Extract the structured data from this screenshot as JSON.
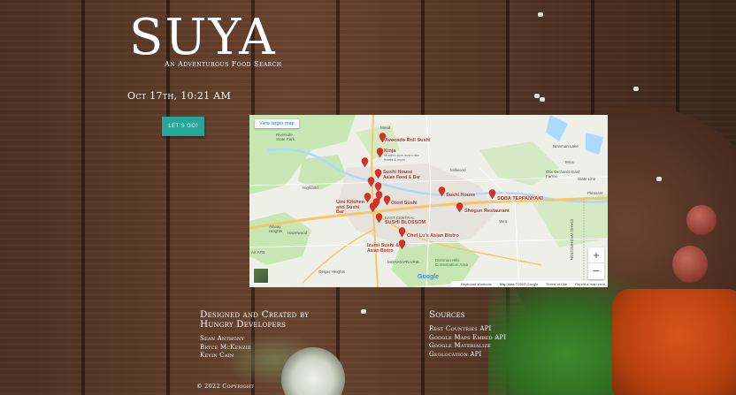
{
  "brand": {
    "title": "SUYA",
    "tagline": "An Adventurous Food Search"
  },
  "datetime": "Oct 17th, 10:21 AM",
  "lets_go_label": "LET'S GO!",
  "map": {
    "view_larger": "View larger map",
    "zoom_in": "+",
    "zoom_out": "−",
    "google": "Google",
    "footer": {
      "shortcuts": "Keyboard shortcuts",
      "data": "Map data ©2022 Google",
      "terms": "Terms of Use",
      "report": "Report a map error"
    },
    "places": [
      {
        "id": "mead",
        "label": "Mead"
      },
      {
        "id": "newman",
        "label": "Newman Lake"
      },
      {
        "id": "mica",
        "label": "Mica"
      },
      {
        "id": "otis",
        "label": "Otis Orchards-East Farms"
      },
      {
        "id": "stateline",
        "label": "State Line"
      },
      {
        "id": "pleasant",
        "label": "Pleasant"
      },
      {
        "id": "highland",
        "label": "Highland"
      },
      {
        "id": "airway",
        "label": "Airway Heights"
      },
      {
        "id": "hazelwood",
        "label": "Hazelwood"
      },
      {
        "id": "fairafb",
        "label": "Air AFB"
      },
      {
        "id": "geiger",
        "label": "Geiger Heights"
      },
      {
        "id": "vera",
        "label": "Vera"
      },
      {
        "id": "millwood",
        "label": "Millwood"
      },
      {
        "id": "east_central",
        "label": "EAST CENTRAL"
      },
      {
        "id": "moran",
        "label": "MORAN PRAIRIE"
      },
      {
        "id": "riverside",
        "label": "Riverside State Park"
      },
      {
        "id": "dishman",
        "label": "Dishman Hills Conservation Area"
      },
      {
        "id": "idaho",
        "label": "IDAHO WASHINGTON"
      }
    ],
    "pins": [
      {
        "id": "avocado",
        "label": "Avocado Roll Sushi",
        "sub": ""
      },
      {
        "id": "kinja",
        "label": "Kinja",
        "sub": "Modern spin sushi rice bowls & more"
      },
      {
        "id": "sushi_house_asian",
        "label": "Sushi House",
        "sub": "Asian Food & Bar"
      },
      {
        "id": "otori",
        "label": "Otori Sushi",
        "sub": ""
      },
      {
        "id": "umi",
        "label": "Umi Kitchen and Sushi Bar",
        "sub": ""
      },
      {
        "id": "blossom",
        "label": "SUSHI BLOSSOM",
        "sub": ""
      },
      {
        "id": "sushi_house_east",
        "label": "Sushi House",
        "sub": ""
      },
      {
        "id": "soba",
        "label": "SOBA TEPPANYAKI",
        "sub": ""
      },
      {
        "id": "shogun",
        "label": "Shogun Restaurant",
        "sub": ""
      },
      {
        "id": "chef_lus",
        "label": "Chef Lu's Asian Bistro",
        "sub": ""
      },
      {
        "id": "izumi",
        "label": "Izumi Sushi &",
        "sub": "Asian Bistro"
      }
    ]
  },
  "footer": {
    "credits_heading": "Designed and Created by Hungry Developers",
    "developers": [
      "Sean Anthony",
      "Bryce McKenzie",
      "Kevin Cain"
    ],
    "sources_heading": "Sources",
    "sources": [
      "Rest Countries API",
      "Google Maps Embed API",
      "Google Materialize",
      "Geolocation API"
    ],
    "copyright": "© 2022 Copyright"
  },
  "colors": {
    "button": "#26a69a",
    "pin": "#d93025",
    "water": "#aadaff",
    "park": "#c8e6b4",
    "highway": "#f5c66b"
  }
}
